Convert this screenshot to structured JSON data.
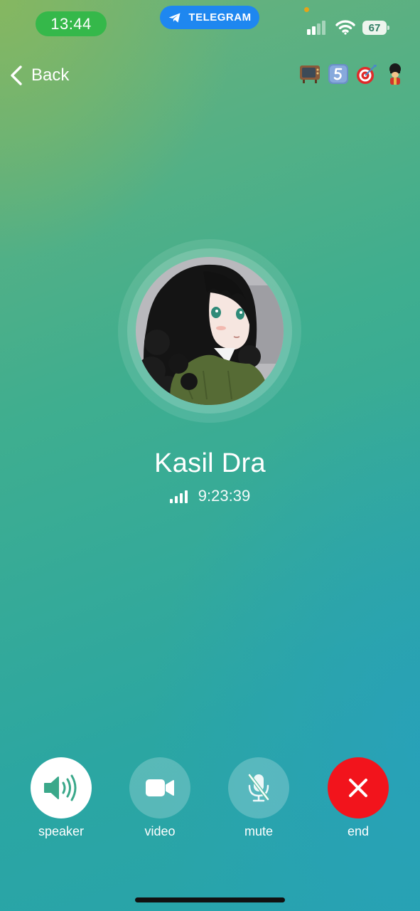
{
  "status_bar": {
    "time": "13:44",
    "app_pill": "TELEGRAM",
    "battery": "67"
  },
  "nav": {
    "back_label": "Back"
  },
  "contact": {
    "name": "Kasil Dra",
    "call_duration": "9:23:39"
  },
  "emoji_status": [
    "tv-emoji",
    "keycap-5-emoji",
    "dart-target-emoji",
    "guard-emoji"
  ],
  "controls": [
    {
      "label": "speaker",
      "icon": "speaker-icon"
    },
    {
      "label": "video",
      "icon": "video-camera-icon"
    },
    {
      "label": "mute",
      "icon": "mic-off-icon"
    },
    {
      "label": "end",
      "icon": "close-icon"
    }
  ],
  "colors": {
    "end_call": "#f2141c",
    "time_pill": "#35b84a",
    "telegram_pill": "#1e87f0",
    "speaker_icon": "#3aa88a"
  }
}
